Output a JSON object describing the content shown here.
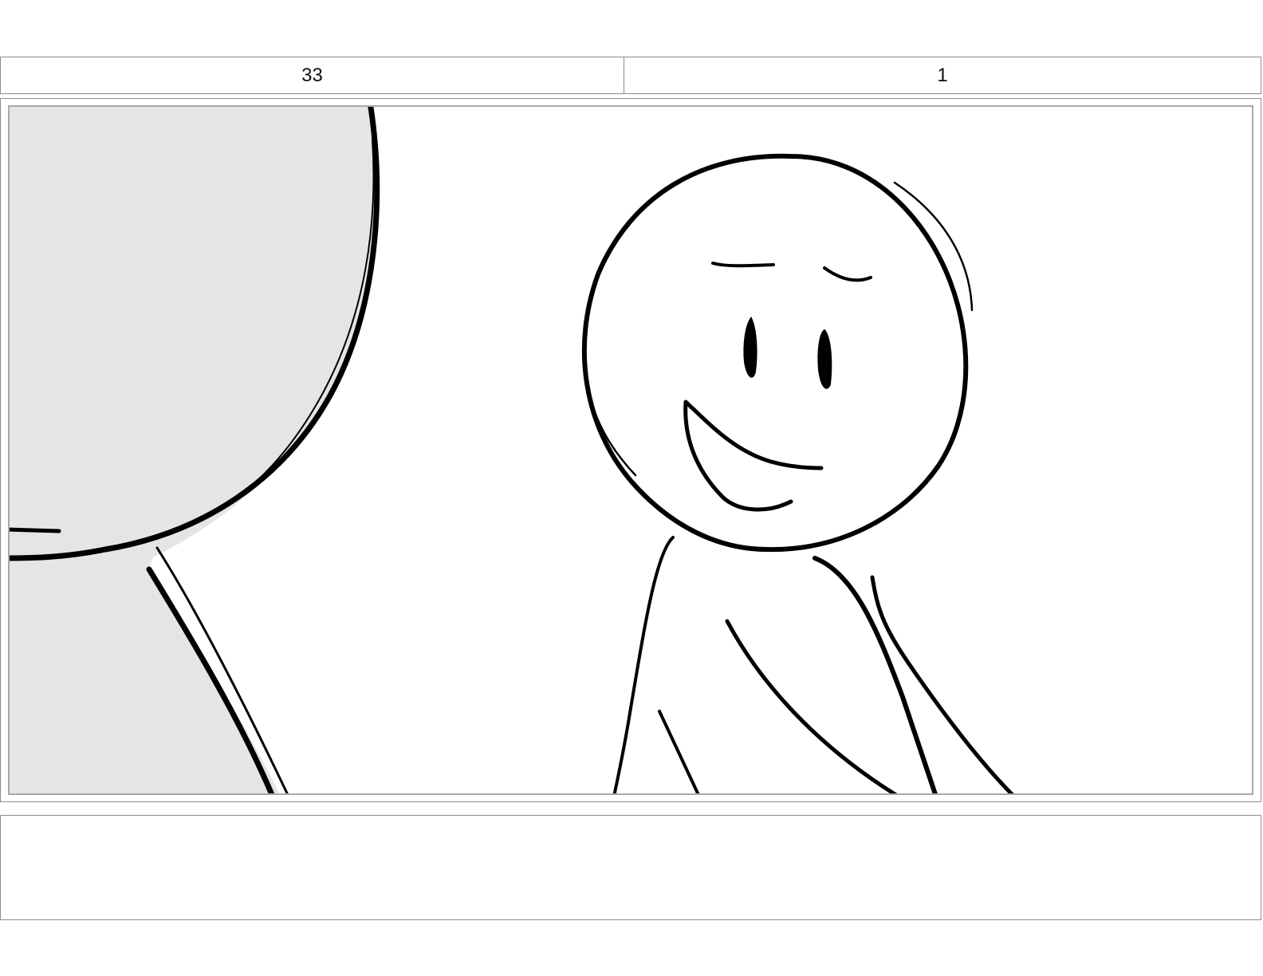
{
  "header": {
    "scene_number": "33",
    "panel_number": "1"
  },
  "frame": {
    "drawing": "storyboard-sketch",
    "characters": [
      "foreground-character-back-of-head",
      "smiling-stick-figure"
    ],
    "colors": {
      "ink": "#000000",
      "foreground_fill": "#e5e5e5",
      "paper": "#ffffff"
    }
  },
  "notes": {
    "text": ""
  }
}
